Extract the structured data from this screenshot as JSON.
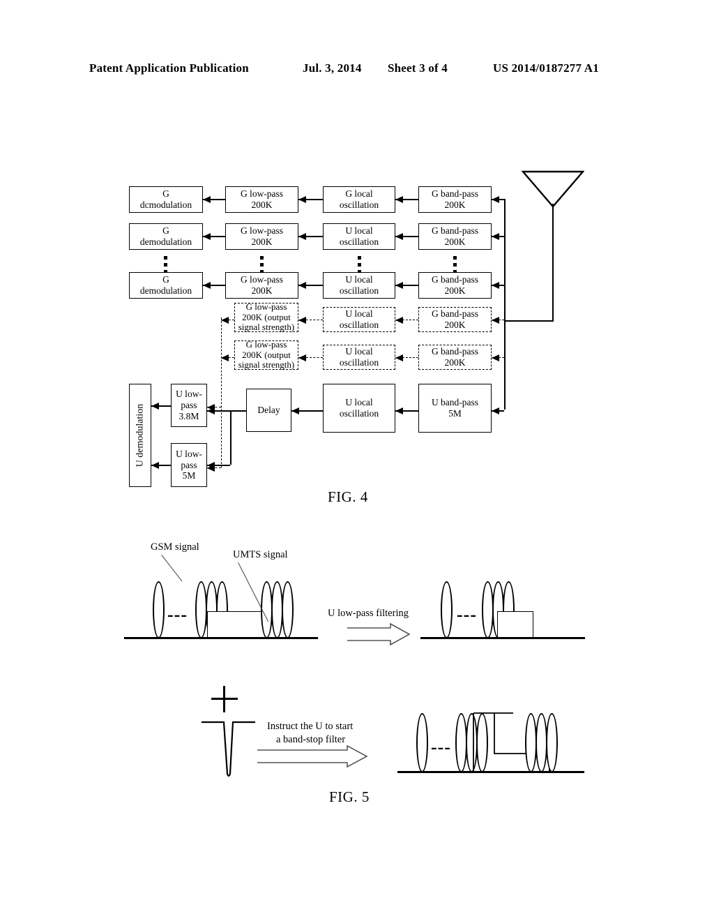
{
  "header": {
    "publication": "Patent Application Publication",
    "date": "Jul. 3, 2014",
    "sheet": "Sheet 3 of 4",
    "number": "US 2014/0187277 A1"
  },
  "fig4": {
    "label": "FIG. 4",
    "antenna_label": "antenna",
    "rows": [
      {
        "demod": "G\ndcmodulation",
        "lowpass": "G low-pass\n200K",
        "oscillation": "G local\noscillation",
        "bandpass": "G band-pass\n200K",
        "style": "solid"
      },
      {
        "demod": "G\ndemodulation",
        "lowpass": "G low-pass\n200K",
        "oscillation": "U local\noscillation",
        "bandpass": "G band-pass\n200K",
        "style": "solid"
      },
      {
        "demod": "G\ndemodulation",
        "lowpass": "G low-pass\n200K",
        "oscillation": "U local\noscillation",
        "bandpass": "G band-pass\n200K",
        "style": "solid"
      },
      {
        "demod": "",
        "lowpass": "G low-pass\n200K (output\nsignal strength)",
        "oscillation": "U local\noscillation",
        "bandpass": "G band-pass\n200K",
        "style": "dashed"
      },
      {
        "demod": "",
        "lowpass": "G low-pass\n200K (output\nsignal strength)",
        "oscillation": "U local\noscillation",
        "bandpass": "G band-pass\n200K",
        "style": "dashed"
      }
    ],
    "bottom": {
      "demodulation": "U demodulation",
      "lowpass_a": "U low-\npass\n3.8M",
      "lowpass_b": "U low-\npass\n5M",
      "delay": "Delay",
      "oscillation": "U local\noscillation",
      "bandpass": "U band-pass\n5M"
    }
  },
  "fig5": {
    "label": "FIG. 5",
    "gsm_label": "GSM signal",
    "umts_label": "UMTS signal",
    "ellipsis": "---",
    "arrow1_label": "U low-pass filtering",
    "arrow2_label_line1": "Instruct the U to start",
    "arrow2_label_line2": "a band-stop filter",
    "plus": "+"
  },
  "colors": {
    "ink": "#000000",
    "paper": "#ffffff",
    "callout": "#555555"
  }
}
